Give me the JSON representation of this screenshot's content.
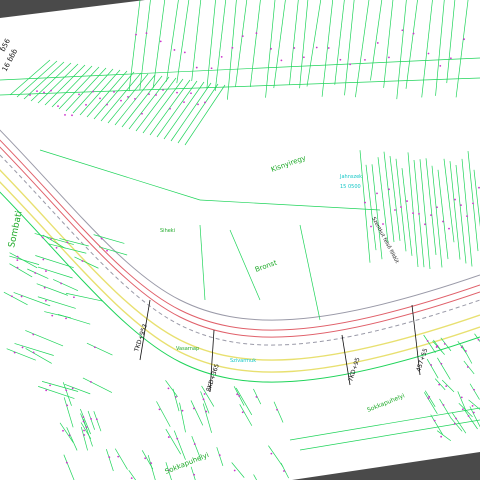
{
  "colors": {
    "background": "#4a4a4a",
    "sheet": "#ffffff",
    "parcel_lines": "#1fd45a",
    "road_red": "#e0606a",
    "road_yellow": "#e8e070",
    "road_gray": "#9a9aa8",
    "label_green": "#1faa2a",
    "label_cyan": "#13c7c7",
    "label_black": "#111111",
    "point_magenta": "#cc33cc"
  },
  "labels": {
    "place_sombath": "Sombati",
    "place_kisnyiregy": "Kisnyiregy",
    "place_siheki": "Siheki",
    "place_bronst": "Bronst",
    "place_roadstrip": "Vasarnap",
    "place_lower": "Szivarmuk",
    "place_bottom": "Sokkapuhelyi",
    "place_cyan_top": "Jahnszek",
    "place_cyan_top2": "15 0500",
    "station_1": "TKD+953",
    "station_2": "8KD+365",
    "station_3": "7KD+95",
    "station_4": "4S7+55",
    "road_label": "Szentkut felső földút",
    "corner_left_1": "ɓ56",
    "corner_left_2": "16 ɓɓɓ"
  }
}
